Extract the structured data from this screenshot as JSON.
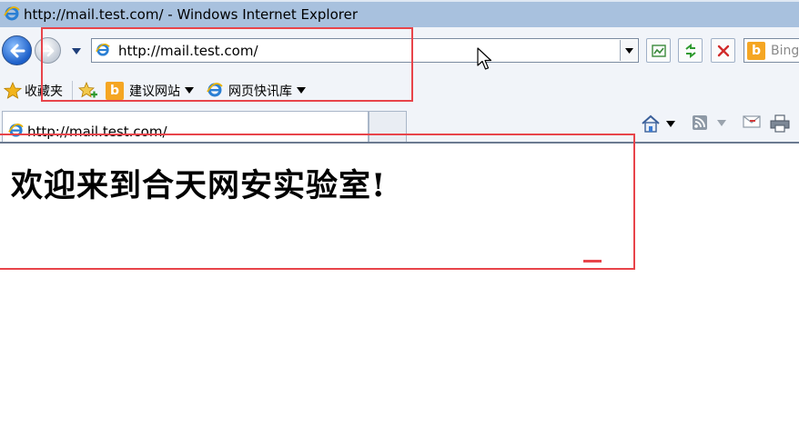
{
  "window": {
    "title": "http://mail.test.com/ - Windows Internet Explorer"
  },
  "address_bar": {
    "url": "http://mail.test.com/"
  },
  "search": {
    "placeholder": "Bing"
  },
  "favorites_bar": {
    "favorites_label": "收藏夹",
    "items": [
      {
        "label": "建议网站",
        "icon": "bing-icon"
      },
      {
        "label": "网页快讯库",
        "icon": "ie-icon"
      }
    ]
  },
  "tab": {
    "title": "http://mail.test.com/"
  },
  "page": {
    "heading": "欢迎来到合天网安实验室!"
  },
  "colors": {
    "annotation": "#e8444a",
    "titlebar": "#a8c1de",
    "chrome": "#f1f4f9"
  },
  "icons": [
    "ie-icon",
    "back-arrow-icon",
    "forward-arrow-icon",
    "compat-icon",
    "refresh-icon",
    "stop-icon",
    "bing-icon",
    "star-icon",
    "add-favorite-icon",
    "home-icon",
    "feeds-icon",
    "mail-icon",
    "print-icon",
    "mouse-cursor-icon"
  ]
}
